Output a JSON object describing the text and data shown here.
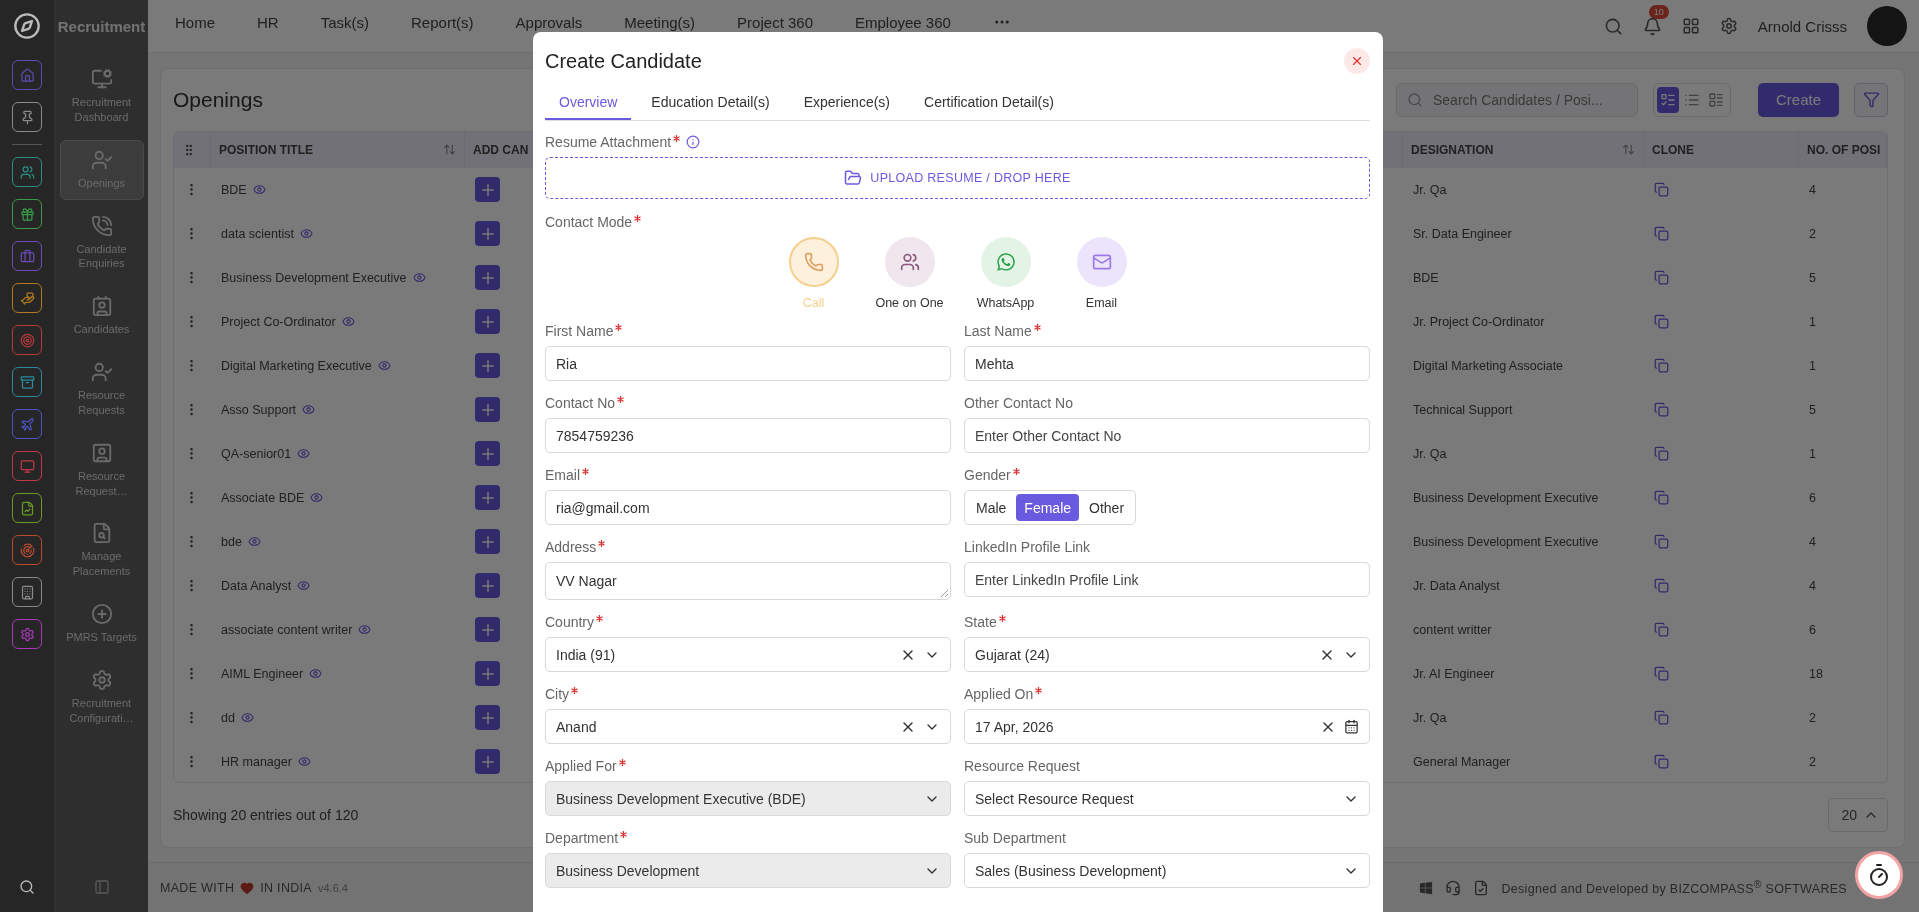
{
  "app": {
    "name": "Recruitment"
  },
  "rail": {
    "items": [
      {
        "color": "#5a4db0"
      },
      {
        "color": "#8a8a8a"
      },
      {
        "color": "#2a8f80"
      },
      {
        "color": "#3a9a4a"
      },
      {
        "color": "#6a4ab5"
      },
      {
        "color": "#b07a20"
      },
      {
        "color": "#b83838"
      },
      {
        "color": "#2a8aa0"
      },
      {
        "color": "#5050c0"
      },
      {
        "color": "#c03848"
      },
      {
        "color": "#6a9a20"
      },
      {
        "color": "#b84a30"
      },
      {
        "color": "#8a8a8a"
      },
      {
        "color": "#a838b8"
      }
    ]
  },
  "sidebar": {
    "items": [
      {
        "label": "Recruitment Dashboard",
        "selected": false
      },
      {
        "label": "Openings",
        "selected": true
      },
      {
        "label": "Candidate Enquiries",
        "selected": false
      },
      {
        "label": "Candidates",
        "selected": false
      },
      {
        "label": "Resource Requests",
        "selected": false
      },
      {
        "label": "Resource Request…",
        "selected": false
      },
      {
        "label": "Manage Placements",
        "selected": false
      },
      {
        "label": "PMRS Targets",
        "selected": false
      },
      {
        "label": "Recruitment Configurati…",
        "selected": false
      }
    ]
  },
  "nav": {
    "items": [
      "Home",
      "HR",
      "Task(s)",
      "Report(s)",
      "Approvals",
      "Meeting(s)",
      "Project 360",
      "Employee 360"
    ]
  },
  "user": {
    "name": "Arnold Crisss",
    "notifications": "10"
  },
  "page": {
    "title": "Openings",
    "search": {
      "placeholder": "Search Candidates / Posi..."
    },
    "views": [
      {
        "selected": true
      },
      {
        "selected": false
      },
      {
        "selected": false
      }
    ],
    "create": "Create",
    "table": {
      "columns": [
        {
          "label": "POSITION TITLE",
          "sortable": true
        },
        {
          "label": "ADD CAN",
          "sortable": false
        },
        {
          "label": "DESIGNATION",
          "sortable": true
        },
        {
          "label": "CLONE",
          "sortable": false
        },
        {
          "label": "NO. OF POSI",
          "sortable": false
        }
      ],
      "rows": [
        {
          "title": "BDE",
          "designation": "Jr. Qa",
          "positions": "4"
        },
        {
          "title": "data scientist",
          "designation": "Sr. Data Engineer",
          "positions": "2"
        },
        {
          "title": "Business Development Executive",
          "designation": "BDE",
          "positions": "5"
        },
        {
          "title": "Project Co-Ordinator",
          "designation": "Jr. Project Co-Ordinator",
          "positions": "1"
        },
        {
          "title": "Digital Marketing Executive",
          "designation": "Digital Marketing Associate",
          "positions": "1"
        },
        {
          "title": "Asso Support",
          "designation": "Technical Support",
          "positions": "5"
        },
        {
          "title": "QA-senior01",
          "designation": "Jr. Qa",
          "positions": "1"
        },
        {
          "title": "Associate BDE",
          "designation": "Business Development Executive",
          "positions": "6"
        },
        {
          "title": "bde",
          "designation": "Business Development Executive",
          "positions": "4"
        },
        {
          "title": "Data Analyst",
          "designation": "Jr. Data Analyst",
          "positions": "4"
        },
        {
          "title": "associate content writer",
          "designation": "content writter",
          "positions": "6"
        },
        {
          "title": "AIML Engineer",
          "designation": "Jr. AI Engineer",
          "positions": "18"
        },
        {
          "title": "dd",
          "designation": "Jr. Qa",
          "positions": "2"
        },
        {
          "title": "HR manager",
          "designation": "General Manager",
          "positions": "2"
        }
      ]
    },
    "summary": "Showing 20 entries out of 120",
    "page_size": "20"
  },
  "footer": {
    "made_with": "MADE WITH",
    "in_india": "IN INDIA",
    "version": "v4.6.4",
    "credit": "Designed and Developed by  BIZCOMPASS$^{®}$ SOFTWARES"
  },
  "modal": {
    "title": "Create Candidate",
    "tabs": [
      {
        "label": "Overview",
        "selected": true
      },
      {
        "label": "Education Detail(s)",
        "selected": false
      },
      {
        "label": "Experience(s)",
        "selected": false
      },
      {
        "label": "Certification Detail(s)",
        "selected": false
      }
    ],
    "resume": {
      "label": "Resume Attachment",
      "required": true,
      "upload": "UPLOAD RESUME / DROP HERE"
    },
    "contact_mode": {
      "label": "Contact Mode",
      "required": true,
      "options": [
        {
          "kind": "call",
          "label": "Call",
          "selected": true
        },
        {
          "kind": "meeting",
          "label": "One on One",
          "selected": false
        },
        {
          "kind": "whatsapp",
          "label": "WhatsApp",
          "selected": false
        },
        {
          "kind": "email",
          "label": "Email",
          "selected": false
        }
      ]
    },
    "fields": [
      {
        "kind": "input",
        "label": "First Name",
        "required": true,
        "value": "Ria"
      },
      {
        "kind": "input",
        "label": "Last Name",
        "required": true,
        "value": "Mehta"
      },
      {
        "kind": "input",
        "label": "Contact No",
        "required": true,
        "value": "7854759236"
      },
      {
        "kind": "input",
        "label": "Other Contact No",
        "required": false,
        "placeholder": "Enter Other Contact No"
      },
      {
        "kind": "input",
        "label": "Email",
        "required": true,
        "value": "ria@gmail.com"
      },
      {
        "kind": "segmented",
        "label": "Gender",
        "required": true,
        "options": [
          {
            "label": "Male",
            "selected": false
          },
          {
            "label": "Female",
            "selected": true
          },
          {
            "label": "Other",
            "selected": false
          }
        ]
      },
      {
        "kind": "textarea",
        "label": "Address",
        "required": true,
        "value": "VV Nagar"
      },
      {
        "kind": "input",
        "label": "LinkedIn Profile Link",
        "required": false,
        "placeholder": "Enter LinkedIn Profile Link"
      },
      {
        "kind": "select",
        "label": "Country",
        "required": true,
        "value": "India (91)",
        "clearable": true,
        "disabled": false
      },
      {
        "kind": "select",
        "label": "State",
        "required": true,
        "value": "Gujarat (24)",
        "clearable": true,
        "disabled": false
      },
      {
        "kind": "select",
        "label": "City",
        "required": true,
        "value": "Anand",
        "clearable": true,
        "disabled": false
      },
      {
        "kind": "date",
        "label": "Applied On",
        "required": true,
        "value": "17 Apr, 2026",
        "clearable": true
      },
      {
        "kind": "select",
        "label": "Applied For",
        "required": true,
        "value": "Business Development Executive (BDE)",
        "clearable": false,
        "disabled": true
      },
      {
        "kind": "select",
        "label": "Resource Request",
        "required": false,
        "value": "Select Resource Request",
        "clearable": false,
        "disabled": false
      },
      {
        "kind": "select",
        "label": "Department",
        "required": true,
        "value": "Business Development",
        "clearable": false,
        "disabled": true
      },
      {
        "kind": "select",
        "label": "Sub Department",
        "required": false,
        "value": "Sales (Business Development)",
        "clearable": false,
        "disabled": false
      }
    ]
  }
}
